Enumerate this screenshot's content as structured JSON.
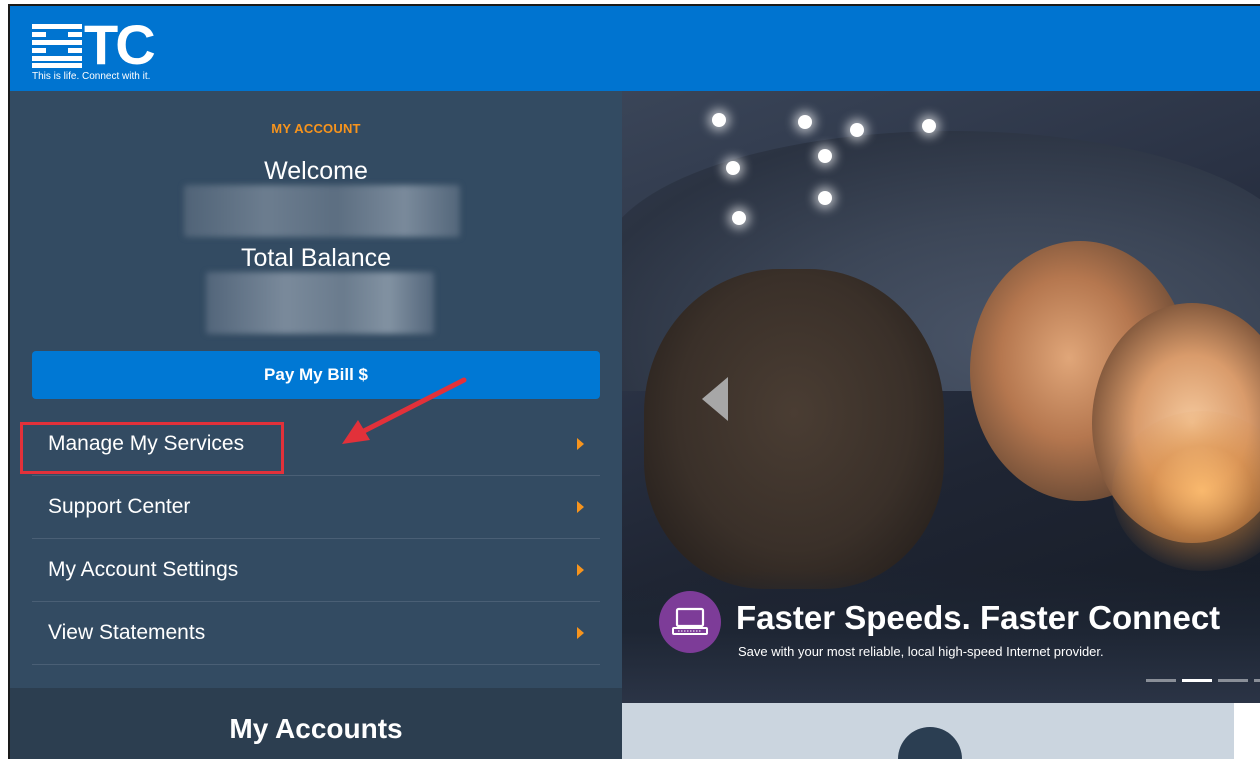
{
  "header": {
    "logo_text": "HTC",
    "logo_tagline": "This is life. Connect with it."
  },
  "sidebar": {
    "section_label": "MY ACCOUNT",
    "welcome": "Welcome",
    "total_balance_label": "Total Balance",
    "pay_button": "Pay My Bill $",
    "menu": [
      {
        "label": "Manage My Services"
      },
      {
        "label": "Support Center"
      },
      {
        "label": "My Account Settings"
      },
      {
        "label": "View Statements"
      }
    ],
    "my_accounts_title": "My Accounts"
  },
  "hero": {
    "headline": "Faster Speeds. Faster Connect",
    "subline": "Save with your most reliable, local high-speed Internet provider.",
    "promo_icon": "laptop-icon",
    "slides_total": 4,
    "active_slide": 2
  },
  "colors": {
    "header_bg": "#0074d0",
    "sidebar_bg": "#334b62",
    "accent_orange": "#f7941d",
    "pay_button_bg": "#0078d4",
    "highlight_red": "#e2313a",
    "promo_purple": "#7d3c98"
  }
}
